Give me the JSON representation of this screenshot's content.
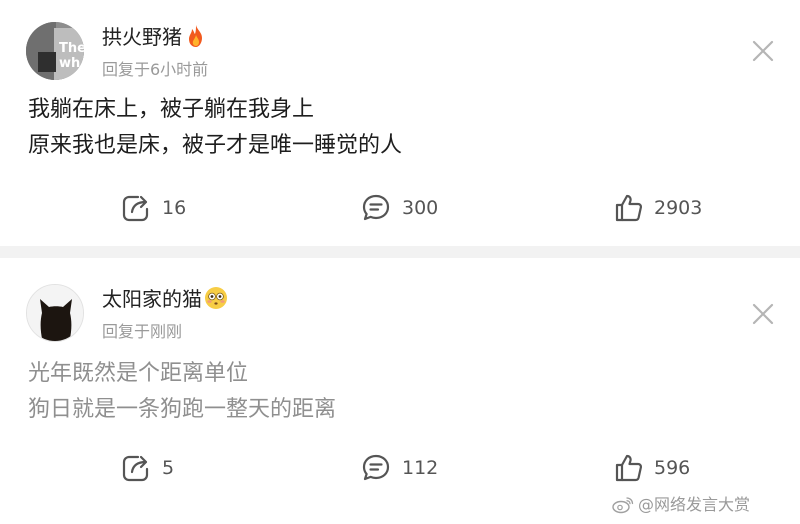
{
  "comments": [
    {
      "username": "拱火野猪",
      "badge_emoji": "fire",
      "reply_time": "回复于6小时前",
      "avatar_text": [
        "The",
        "wh"
      ],
      "lines": [
        "我躺在床上，被子躺在我身上",
        "原来我也是床，被子才是唯一睡觉的人"
      ],
      "share_count": "16",
      "comment_count": "300",
      "like_count": "2903"
    },
    {
      "username": "太阳家的猫",
      "badge_emoji": "flushed-face",
      "reply_time": "回复于刚刚",
      "lines": [
        "光年既然是个距离单位",
        "狗日就是一条狗跑一整天的距离"
      ],
      "share_count": "5",
      "comment_count": "112",
      "like_count": "596"
    }
  ],
  "watermark": "@网络发言大赏",
  "colors": {
    "text_primary": "#1e1e1e",
    "text_secondary": "#9a9a9a",
    "text_faded": "#8f8f8f",
    "icon": "#555555",
    "card": "#ffffff",
    "separator": "#f2f2f2"
  },
  "icons": [
    "fire-icon",
    "flushed-face-icon",
    "close-icon",
    "share-icon",
    "comment-icon",
    "like-icon",
    "weibo-logo-icon"
  ]
}
